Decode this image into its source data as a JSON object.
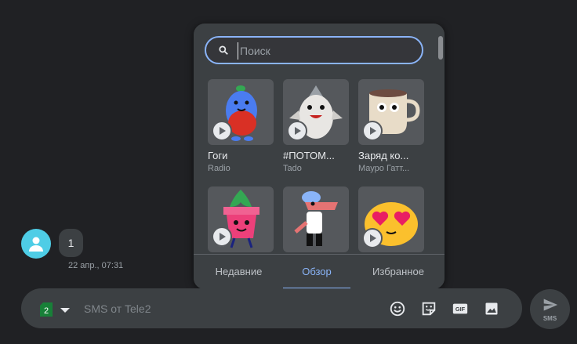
{
  "conversation": {
    "message_text": "1",
    "timestamp": "22 апр., 07:31",
    "avatar_icon": "person-icon",
    "avatar_color": "#4ecde6"
  },
  "sticker_panel": {
    "search": {
      "placeholder": "Поиск",
      "value": ""
    },
    "stickers": [
      {
        "name": "Гоги",
        "author": "Radio"
      },
      {
        "name": "#ПОТОМ...",
        "author": "Tado"
      },
      {
        "name": "Заряд ко...",
        "author": "Мауро Гатт..."
      },
      {
        "name": "",
        "author": ""
      },
      {
        "name": "",
        "author": ""
      },
      {
        "name": "",
        "author": ""
      }
    ],
    "tabs": [
      {
        "label": "Недавние",
        "active": false
      },
      {
        "label": "Обзор",
        "active": true
      },
      {
        "label": "Избранное",
        "active": false
      }
    ]
  },
  "compose": {
    "sim_number": "2",
    "placeholder": "SMS от Tele2",
    "icons": [
      "emoji-icon",
      "sticker-icon",
      "gif-icon",
      "image-icon"
    ],
    "send_label": "SMS"
  },
  "colors": {
    "background": "#202124",
    "surface": "#3c4043",
    "accent": "#8ab4f8",
    "sim_green": "#188038"
  }
}
